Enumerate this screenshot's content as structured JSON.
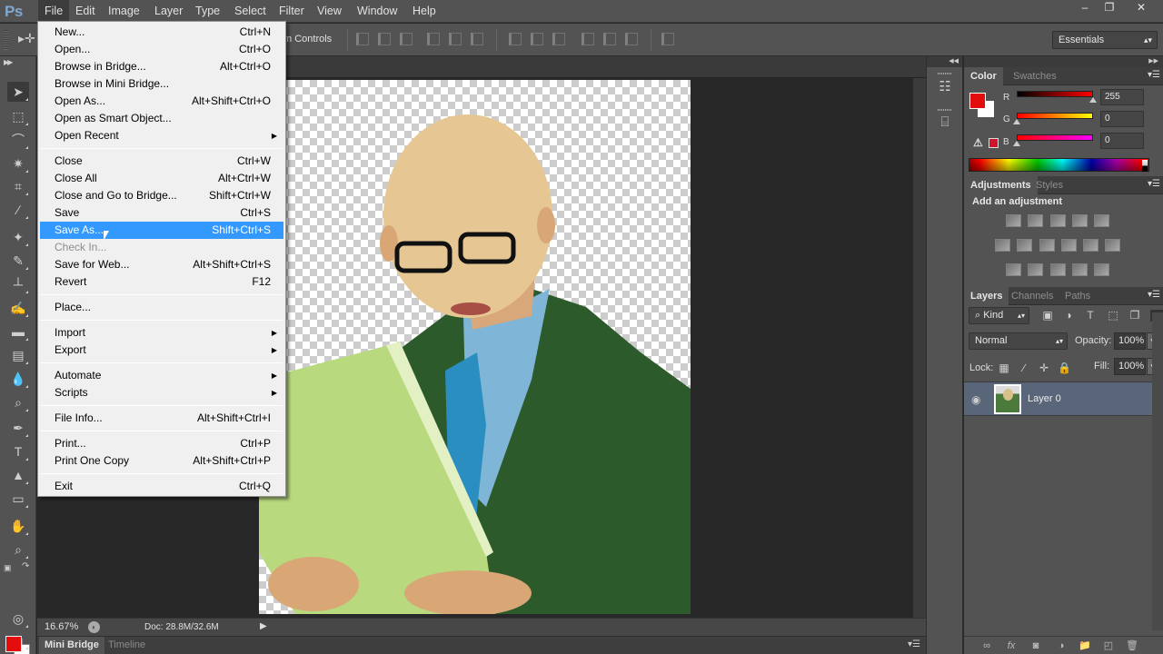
{
  "app": {
    "logo": "Ps",
    "name": "Adobe Photoshop"
  },
  "menubar": {
    "items": [
      "File",
      "Edit",
      "Image",
      "Layer",
      "Type",
      "Select",
      "Filter",
      "View",
      "Window",
      "Help"
    ],
    "active": "File"
  },
  "window_controls": {
    "minimize": "–",
    "restore": "❐",
    "close": "✕"
  },
  "options_bar": {
    "tool_icon": "move-tool-icon",
    "transform_controls_label": "m Controls",
    "workspace": "Essentials"
  },
  "file_menu": {
    "groups": [
      [
        {
          "label": "New...",
          "shortcut": "Ctrl+N"
        },
        {
          "label": "Open...",
          "shortcut": "Ctrl+O"
        },
        {
          "label": "Browse in Bridge...",
          "shortcut": "Alt+Ctrl+O"
        },
        {
          "label": "Browse in Mini Bridge...",
          "shortcut": ""
        },
        {
          "label": "Open As...",
          "shortcut": "Alt+Shift+Ctrl+O"
        },
        {
          "label": "Open as Smart Object...",
          "shortcut": ""
        },
        {
          "label": "Open Recent",
          "shortcut": "",
          "submenu": true
        }
      ],
      [
        {
          "label": "Close",
          "shortcut": "Ctrl+W"
        },
        {
          "label": "Close All",
          "shortcut": "Alt+Ctrl+W"
        },
        {
          "label": "Close and Go to Bridge...",
          "shortcut": "Shift+Ctrl+W"
        },
        {
          "label": "Save",
          "shortcut": "Ctrl+S"
        },
        {
          "label": "Save As...",
          "shortcut": "Shift+Ctrl+S",
          "highlighted": true
        },
        {
          "label": "Check In...",
          "shortcut": "",
          "disabled": true
        },
        {
          "label": "Save for Web...",
          "shortcut": "Alt+Shift+Ctrl+S"
        },
        {
          "label": "Revert",
          "shortcut": "F12"
        }
      ],
      [
        {
          "label": "Place...",
          "shortcut": ""
        }
      ],
      [
        {
          "label": "Import",
          "shortcut": "",
          "submenu": true
        },
        {
          "label": "Export",
          "shortcut": "",
          "submenu": true
        }
      ],
      [
        {
          "label": "Automate",
          "shortcut": "",
          "submenu": true
        },
        {
          "label": "Scripts",
          "shortcut": "",
          "submenu": true
        }
      ],
      [
        {
          "label": "File Info...",
          "shortcut": "Alt+Shift+Ctrl+I"
        }
      ],
      [
        {
          "label": "Print...",
          "shortcut": "Ctrl+P"
        },
        {
          "label": "Print One Copy",
          "shortcut": "Alt+Shift+Ctrl+P"
        }
      ],
      [
        {
          "label": "Exit",
          "shortcut": "Ctrl+Q"
        }
      ]
    ]
  },
  "toolbox": {
    "tools": [
      "move",
      "rectangular-marquee",
      "lasso",
      "magic-wand",
      "crop",
      "eyedropper",
      "spot-healing-brush",
      "brush",
      "clone-stamp",
      "history-brush",
      "eraser",
      "gradient",
      "blur",
      "dodge",
      "pen",
      "type",
      "path-selection",
      "rectangle",
      "hand",
      "zoom"
    ],
    "selected": "move",
    "foreground_color": "#e30d0d",
    "background_color": "#ffffff"
  },
  "status_bar": {
    "zoom": "16.67%",
    "doc_size": "Doc: 28.8M/32.6M"
  },
  "bottom_panel": {
    "tabs": [
      "Mini Bridge",
      "Timeline"
    ],
    "active": "Mini Bridge"
  },
  "color_panel": {
    "tabs": [
      "Color",
      "Swatches"
    ],
    "active": "Color",
    "channels": [
      {
        "label": "R",
        "value": "255"
      },
      {
        "label": "G",
        "value": "0"
      },
      {
        "label": "B",
        "value": "0"
      }
    ],
    "foreground": "#e30d0d"
  },
  "adjustments_panel": {
    "tabs": [
      "Adjustments",
      "Styles"
    ],
    "active": "Adjustments",
    "title": "Add an adjustment",
    "rows": [
      [
        "brightness-contrast",
        "levels",
        "curves",
        "exposure",
        "vibrance"
      ],
      [
        "hue-saturation",
        "color-balance",
        "black-white",
        "photo-filter",
        "channel-mixer",
        "color-lookup"
      ],
      [
        "invert",
        "posterize",
        "threshold",
        "selective-color",
        "gradient-map"
      ]
    ]
  },
  "layers_panel": {
    "tabs": [
      "Layers",
      "Channels",
      "Paths"
    ],
    "active": "Layers",
    "filter": "Kind",
    "blend_mode": "Normal",
    "opacity_label": "Opacity:",
    "opacity": "100%",
    "lock_label": "Lock:",
    "fill_label": "Fill:",
    "fill": "100%",
    "layers": [
      {
        "name": "Layer 0",
        "visible": true,
        "selected": true
      }
    ]
  }
}
